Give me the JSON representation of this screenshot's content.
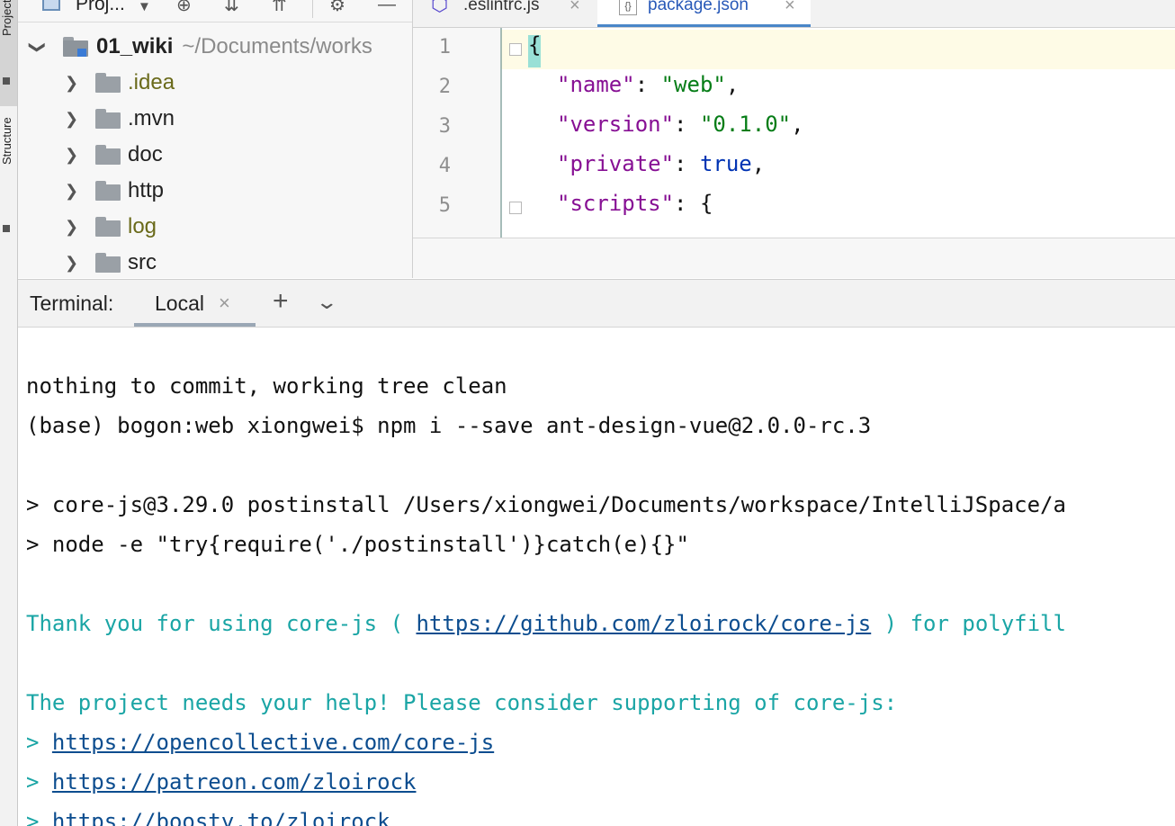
{
  "sidebar": {
    "project_tab": "Project",
    "structure_tab": "Structure"
  },
  "project_panel": {
    "view_label": "Proj...",
    "root": {
      "name": "01_wiki",
      "path": "~/Documents/works"
    },
    "items": [
      {
        "label": ".idea",
        "color": "#6a6a1a"
      },
      {
        "label": ".mvn",
        "color": "#222222"
      },
      {
        "label": "doc",
        "color": "#222222"
      },
      {
        "label": "http",
        "color": "#222222"
      },
      {
        "label": "log",
        "color": "#6a6a1a"
      },
      {
        "label": "src",
        "color": "#222222"
      }
    ]
  },
  "editor": {
    "tabs": [
      {
        "label": ".eslintrc.js",
        "icon": "eslint-icon"
      },
      {
        "label": "package.json",
        "icon": "json-file-icon",
        "active": true
      }
    ],
    "line_numbers": [
      "1",
      "2",
      "3",
      "4",
      "5"
    ],
    "lines": [
      {
        "open": "{"
      },
      {
        "key": "\"name\"",
        "colon": ": ",
        "value": "\"web\"",
        "end": ","
      },
      {
        "key": "\"version\"",
        "colon": ": ",
        "value": "\"0.1.0\"",
        "end": ","
      },
      {
        "key": "\"private\"",
        "colon": ": ",
        "value": "true",
        "end": ","
      },
      {
        "key": "\"scripts\"",
        "colon": ": ",
        "value": "{",
        "end": ""
      }
    ]
  },
  "terminal": {
    "title": "Terminal:",
    "tab_label": "Local",
    "lines": [
      "nothing to commit, working tree clean",
      "(base) bogon:web xiongwei$ npm i --save ant-design-vue@2.0.0-rc.3",
      "> core-js@3.29.0 postinstall /Users/xiongwei/Documents/workspace/IntelliJSpace/a",
      "> node -e \"try{require('./postinstall')}catch(e){}\""
    ],
    "thanks": {
      "prefix": "Thank you for using core-js ( ",
      "link": "https://github.com/zloirock/core-js",
      "suffix": " ) for polyfill"
    },
    "help_line": "The project needs your help! Please consider supporting of core-js:",
    "support_prefix": "> ",
    "support_links": [
      "https://opencollective.com/core-js",
      "https://patreon.com/zloirock",
      "https://boosty.to/zloirock"
    ]
  },
  "colors": {
    "accent": "#4a86c8",
    "terminal_cyan": "#1aa5a5",
    "json_key": "#871094",
    "json_string": "#067d17",
    "json_keyword": "#0033b3"
  }
}
